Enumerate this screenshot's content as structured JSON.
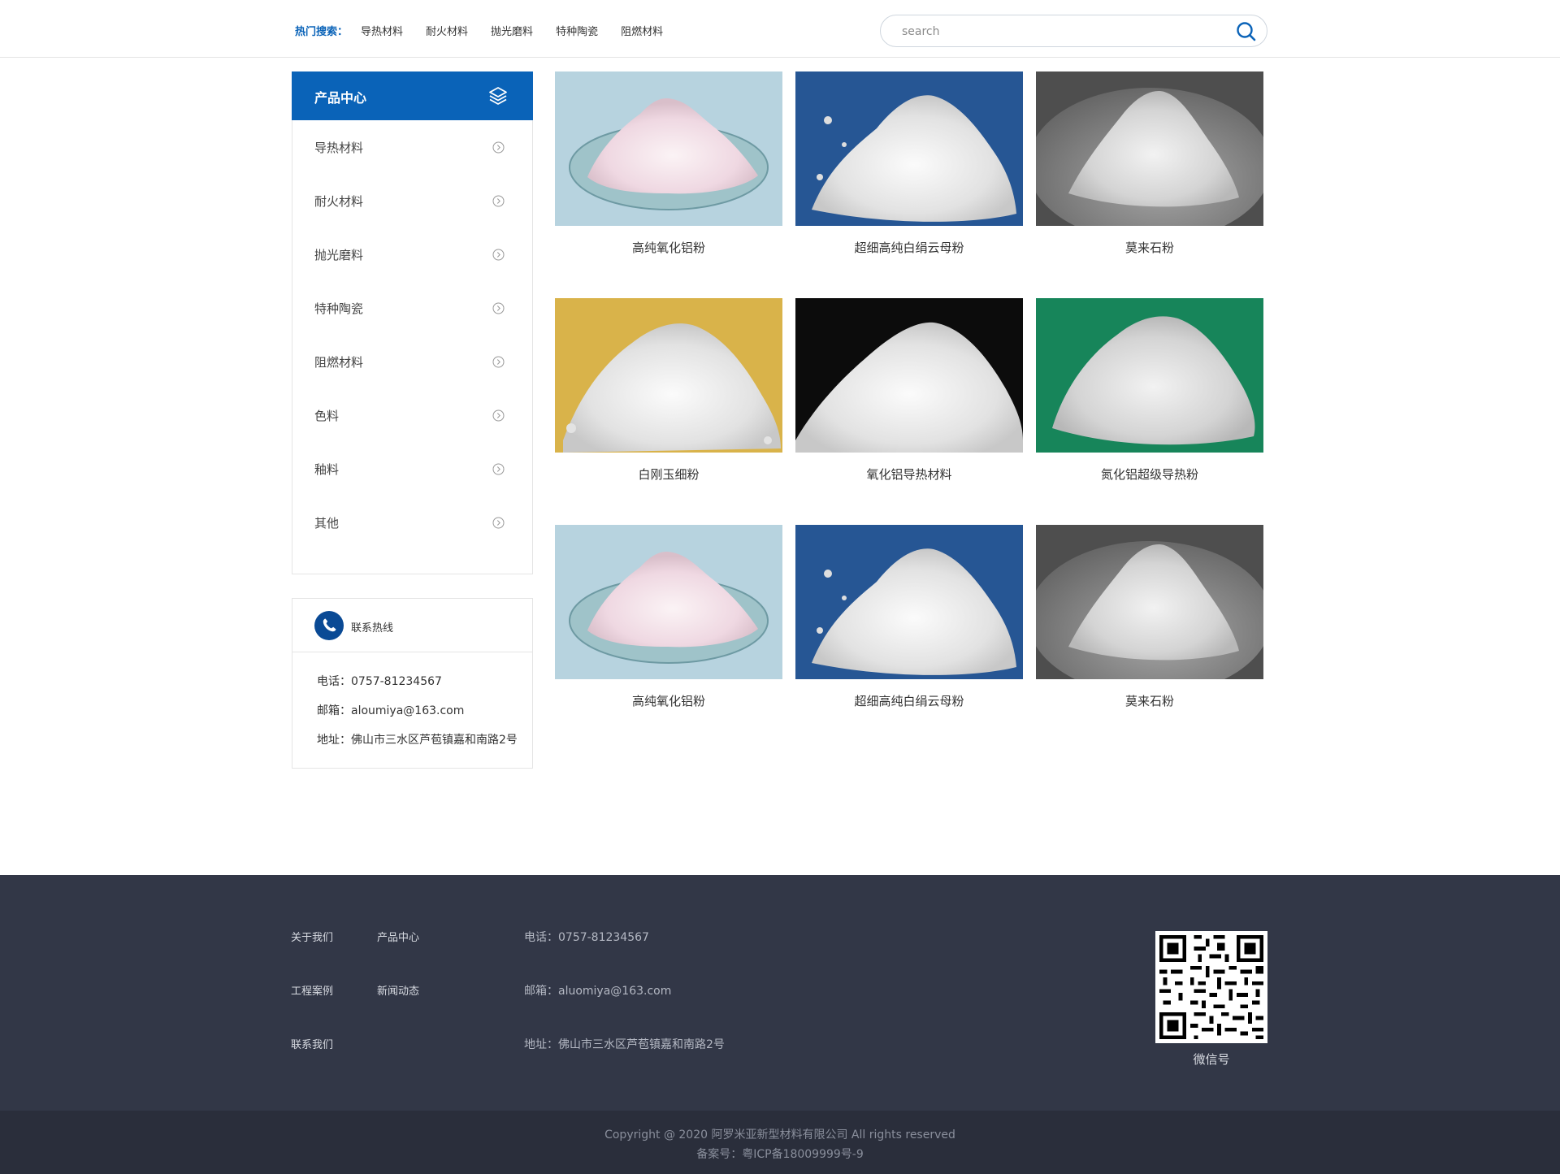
{
  "header": {
    "hot_title": "热门搜索：",
    "hot_items": [
      "导热材料",
      "耐火材料",
      "抛光磨料",
      "特种陶瓷",
      "阻燃材料"
    ],
    "search_placeholder": "search"
  },
  "sidebar": {
    "title": "产品中心",
    "items": [
      "导热材料",
      "耐火材料",
      "抛光磨料",
      "特种陶瓷",
      "阻燃材料",
      "色料",
      "釉料",
      "其他"
    ],
    "contact": {
      "title": "联系热线",
      "phone": "电话：0757-81234567",
      "email": "邮箱：aloumiya@163.com",
      "address": "地址：佛山市三水区芦苞镇嘉和南路2号"
    }
  },
  "products": [
    {
      "name": "高纯氧化铝粉",
      "image": "pink-powder-on-dish"
    },
    {
      "name": "超细高纯白绢云母粉",
      "image": "white-powder-on-blue"
    },
    {
      "name": "莫来石粉",
      "image": "grey-powder-on-plate"
    },
    {
      "name": "白刚玉细粉",
      "image": "white-powder-on-yellow"
    },
    {
      "name": "氧化铝导热材料",
      "image": "white-powder-on-black"
    },
    {
      "name": "氮化铝超级导热粉",
      "image": "white-powder-on-green"
    },
    {
      "name": "高纯氧化铝粉",
      "image": "pink-powder-on-dish"
    },
    {
      "name": "超细高纯白绢云母粉",
      "image": "white-powder-on-blue"
    },
    {
      "name": "莫来石粉",
      "image": "grey-powder-on-plate"
    }
  ],
  "footer": {
    "nav": [
      "关于我们",
      "产品中心",
      "工程案例",
      "新闻动态",
      "联系我们"
    ],
    "phone": "电话：0757-81234567",
    "email": "邮箱：aluomiya@163.com",
    "address": "地址：佛山市三水区芦苞镇嘉和南路2号",
    "qr_label": "微信号",
    "copyright": "Copyright @ 2020 阿罗米亚新型材料有限公司 All rights reserved",
    "icp": "备案号：粤ICP备18009999号-9"
  },
  "colors": {
    "brand_blue": "#0a63b8",
    "footer_bg": "#323747",
    "bottom_bg": "#2a2e3b"
  }
}
